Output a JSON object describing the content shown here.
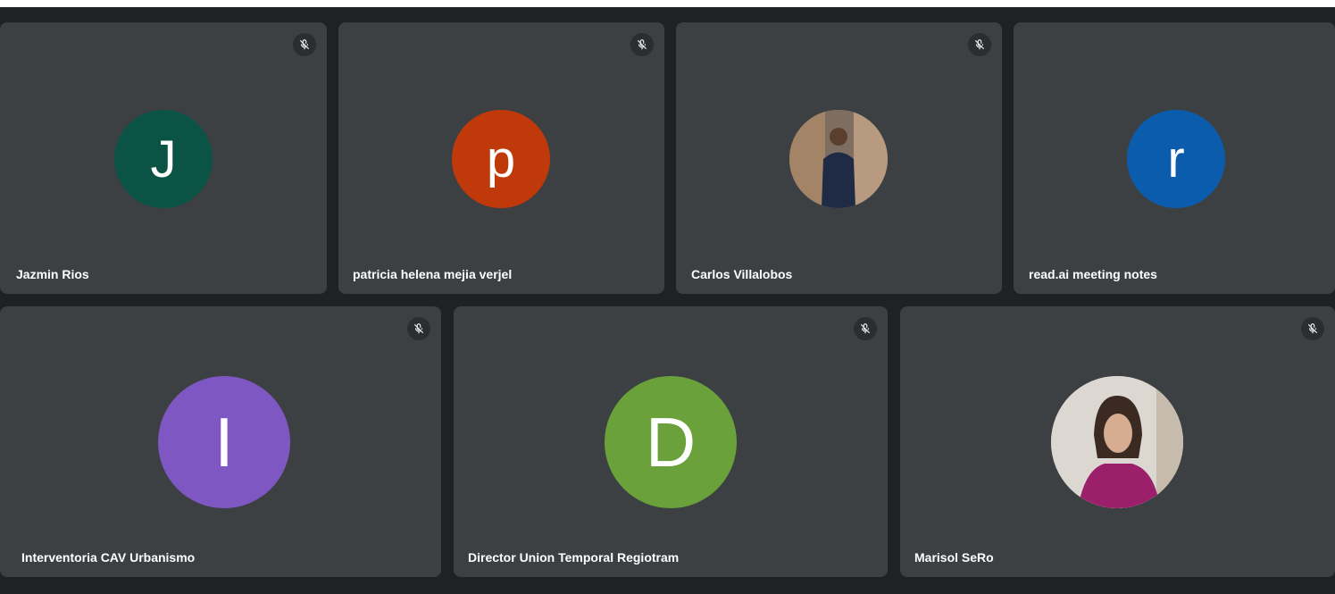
{
  "participants_row1": [
    {
      "name": "Jazmin Rios",
      "initial": "J",
      "color": "#0b5345",
      "type": "initial"
    },
    {
      "name": "patricia helena mejia verjel",
      "initial": "p",
      "color": "#c0390b",
      "type": "initial"
    },
    {
      "name": "Carlos Villalobos",
      "initial": "",
      "color": "#8a7a6a",
      "type": "photo"
    },
    {
      "name": "read.ai meeting notes",
      "initial": "r",
      "color": "#0b5cad",
      "type": "initial"
    }
  ],
  "participants_row2": [
    {
      "name": "Interventoria CAV Urbanismo",
      "initial": "I",
      "color": "#7e57c2",
      "type": "initial"
    },
    {
      "name": "Director Union Temporal Regiotram",
      "initial": "D",
      "color": "#6aa13b",
      "type": "initial"
    },
    {
      "name": "Marisol SeRo",
      "initial": "",
      "color": "#d9d4cf",
      "type": "photo"
    }
  ],
  "icons": {
    "mute": "mic-off-icon"
  }
}
